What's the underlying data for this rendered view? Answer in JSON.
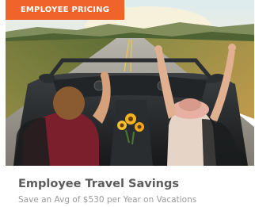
{
  "card": {
    "tag": "EMPLOYEE PRICING",
    "title": "Employee Travel Savings",
    "subtitle": "Save an Avg of $530 per Year on Vacations"
  },
  "colors": {
    "tag_background": "#f0632b",
    "title_text": "#5b5b5b",
    "subtitle_text": "#9a9a9a"
  }
}
